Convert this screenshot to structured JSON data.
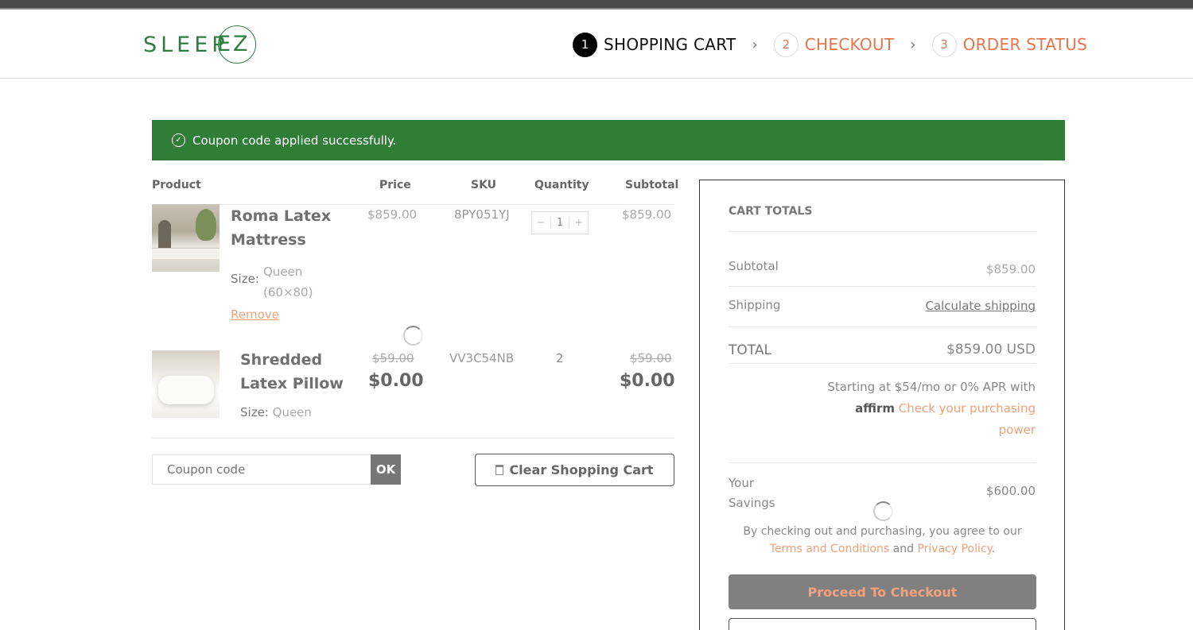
{
  "brand": {
    "logo_text": "SLEEP",
    "logo_suffix": "EZ"
  },
  "steps": [
    {
      "num": "1",
      "label": "SHOPPING CART"
    },
    {
      "num": "2",
      "label": "CHECKOUT"
    },
    {
      "num": "3",
      "label": "ORDER STATUS"
    }
  ],
  "alert": {
    "message": "Coupon code applied successfully."
  },
  "table": {
    "headers": {
      "product": "Product",
      "price": "Price",
      "sku": "SKU",
      "quantity": "Quantity",
      "subtotal": "Subtotal"
    }
  },
  "items": [
    {
      "name_line1": "Roma Latex",
      "name_line2": "Mattress",
      "size_label": "Size:",
      "size_line1": "Queen",
      "size_line2": "(60×80)",
      "remove": "Remove",
      "price": "$859.00",
      "sku": "8PY051YJ",
      "qty": "1",
      "qty_minus": "−",
      "qty_plus": "+",
      "subtotal": "$859.00"
    },
    {
      "name_line1": "Shredded",
      "name_line2": "Latex Pillow",
      "size_label": "Size:",
      "size_value": "Queen",
      "old_price": "$59.00",
      "price": "$0.00",
      "sku": "VV3C54NB",
      "qty": "2",
      "old_subtotal": "$59.00",
      "subtotal": "$0.00"
    }
  ],
  "coupon": {
    "placeholder": "Coupon code",
    "ok": "OK"
  },
  "clear_cart": "Clear Shopping Cart",
  "totals": {
    "title": "CART TOTALS",
    "subtotal_label": "Subtotal",
    "subtotal_value": "$859.00",
    "shipping_label": "Shipping",
    "shipping_link": "Calculate shipping",
    "total_label": "TOTAL",
    "total_value": "$859.00 USD",
    "affirm_text": "Starting at $54/mo or 0% APR with",
    "affirm_logo": "affirm",
    "affirm_link_1": "Check your purchasing",
    "affirm_link_2": "power",
    "savings_label_1": "Your",
    "savings_label_2": "Savings",
    "savings_value": "$600.00",
    "agree_text": "By checking out and purchasing, you agree to our",
    "terms": "Terms and Conditions",
    "and": "and",
    "privacy": "Privacy Policy",
    "period": ".",
    "checkout": "Proceed To Checkout"
  }
}
